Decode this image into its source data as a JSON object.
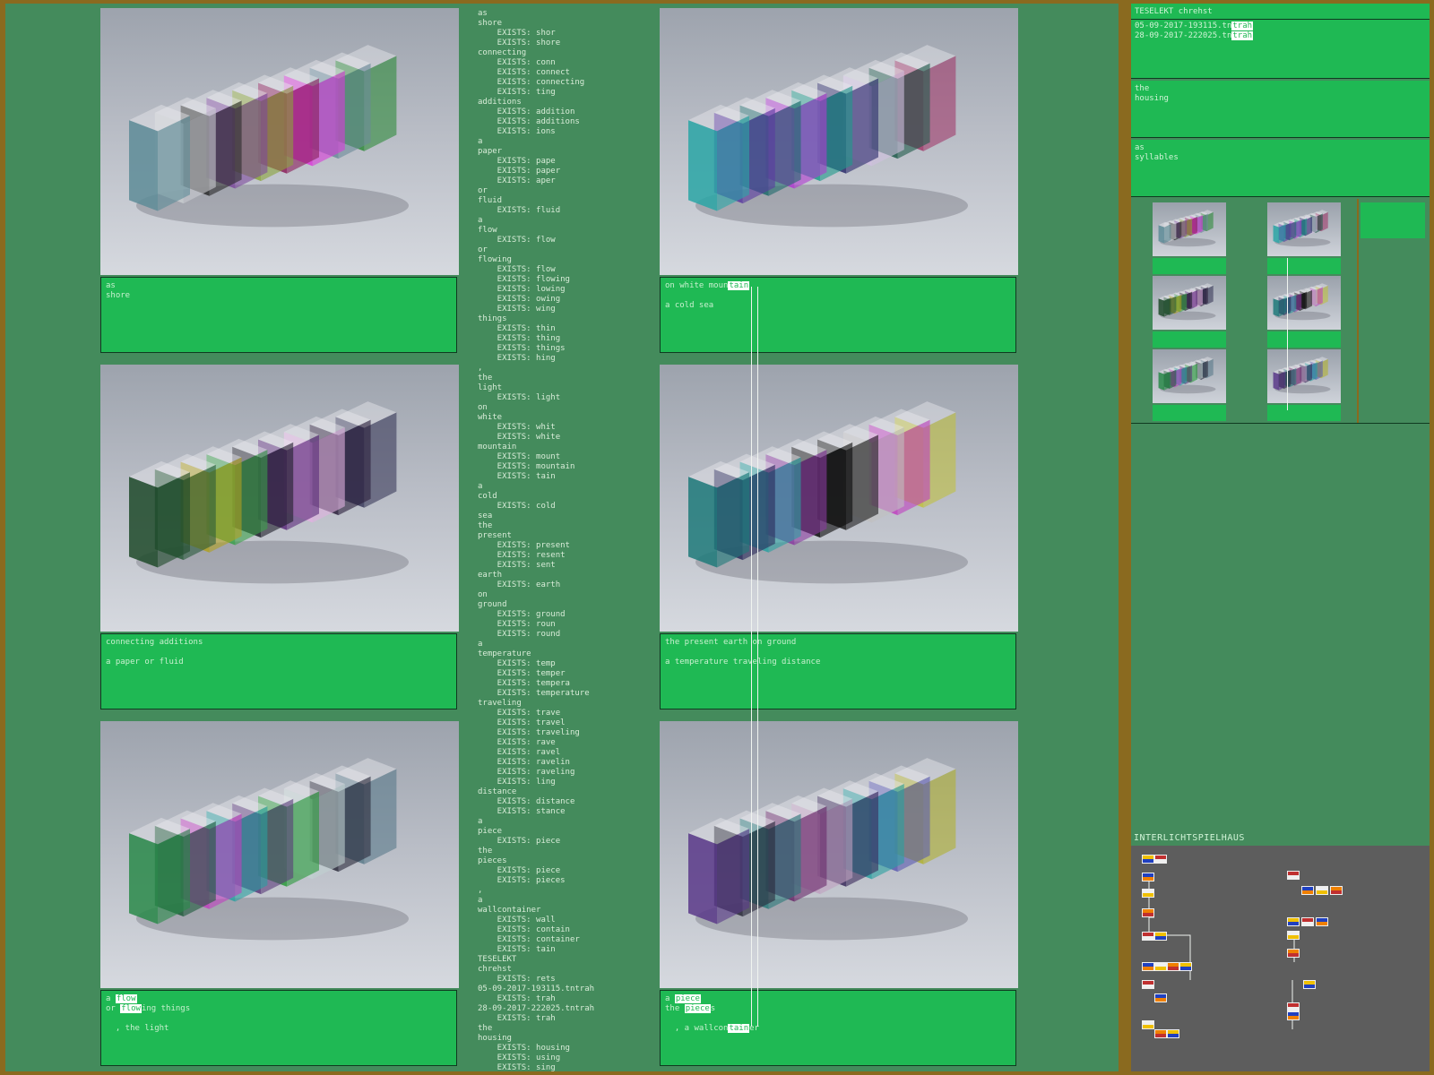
{
  "tiles": [
    {
      "id": "t1",
      "lines": [
        "as",
        "shore"
      ],
      "palette": [
        "#5e8c98",
        "#c9ccd0",
        "#2a2a2a",
        "#7d4a9c",
        "#8aa43a",
        "#8b1e5a",
        "#d93ad8",
        "#6a8b9a",
        "#2f8a3a"
      ]
    },
    {
      "id": "t2",
      "lines": [
        "on white moun[tain]",
        "",
        "a cold sea"
      ],
      "palette": [
        "#2aa6a6",
        "#5a3aa0",
        "#1e6b6b",
        "#b03ad0",
        "#1e9a8a",
        "#2a2a6a",
        "#d0c0e0",
        "#1e5a4a",
        "#a03a6a"
      ]
    },
    {
      "id": "t3",
      "lines": [
        "connecting additions",
        "",
        "a paper or fluid"
      ],
      "palette": [
        "#1e4a2a",
        "#2a5a3a",
        "#b0a020",
        "#3aa04a",
        "#1e1e2a",
        "#5a2a7a",
        "#e0b0e0",
        "#2a1e3a",
        "#3a3a5a"
      ]
    },
    {
      "id": "t4",
      "lines": [
        "the present earth on ground",
        "",
        "a temperature traveling distance"
      ],
      "palette": [
        "#1e7a7a",
        "#2a2a5a",
        "#2aa0a0",
        "#8a3aa0",
        "#0a0a0a",
        "#1e1e1e",
        "#c0c0c0",
        "#c040c0",
        "#c0c040"
      ]
    },
    {
      "id": "t5",
      "lines": [
        "a [flow]",
        "or [flow]ing things",
        "",
        "  , the light"
      ],
      "palette": [
        "#2a8a4a",
        "#1e5a3a",
        "#c040c0",
        "#2aa0a0",
        "#5a3a7a",
        "#2a9a3a",
        "#c0d0d0",
        "#2a2a3a",
        "#5a7a8a"
      ]
    },
    {
      "id": "t6",
      "lines": [
        "a [piece]",
        "the [piece]s",
        "",
        "  , a wallcon[tain]er"
      ],
      "palette": [
        "#5a3a8a",
        "#2a2a3a",
        "#2a7a7a",
        "#6a2a6a",
        "#c0a0c0",
        "#3a2a5a",
        "#2aa0a0",
        "#5a5ab0",
        "#b0b030"
      ]
    }
  ],
  "wordlist": [
    "as",
    "shore",
    "    EXISTS: shor",
    "    EXISTS: shore",
    "connecting",
    "    EXISTS: conn",
    "    EXISTS: connect",
    "    EXISTS: connecting",
    "    EXISTS: ting",
    "additions",
    "    EXISTS: addition",
    "    EXISTS: additions",
    "    EXISTS: ions",
    "a",
    "paper",
    "    EXISTS: pape",
    "    EXISTS: paper",
    "    EXISTS: aper",
    "or",
    "fluid",
    "    EXISTS: fluid",
    "a",
    "flow",
    "    EXISTS: flow",
    "or",
    "flowing",
    "    EXISTS: flow",
    "    EXISTS: flowing",
    "    EXISTS: lowing",
    "    EXISTS: owing",
    "    EXISTS: wing",
    "things",
    "    EXISTS: thin",
    "    EXISTS: thing",
    "    EXISTS: things",
    "    EXISTS: hing",
    ",",
    "the",
    "light",
    "    EXISTS: light",
    "on",
    "white",
    "    EXISTS: whit",
    "    EXISTS: white",
    "mountain",
    "    EXISTS: mount",
    "    EXISTS: mountain",
    "    EXISTS: tain",
    "a",
    "cold",
    "    EXISTS: cold",
    "sea",
    "the",
    "present",
    "    EXISTS: present",
    "    EXISTS: resent",
    "    EXISTS: sent",
    "earth",
    "    EXISTS: earth",
    "on",
    "ground",
    "    EXISTS: ground",
    "    EXISTS: roun",
    "    EXISTS: round",
    "a",
    "temperature",
    "    EXISTS: temp",
    "    EXISTS: temper",
    "    EXISTS: tempera",
    "    EXISTS: temperature",
    "traveling",
    "    EXISTS: trave",
    "    EXISTS: travel",
    "    EXISTS: traveling",
    "    EXISTS: rave",
    "    EXISTS: ravel",
    "    EXISTS: ravelin",
    "    EXISTS: raveling",
    "    EXISTS: ling",
    "distance",
    "    EXISTS: distance",
    "    EXISTS: stance",
    "a",
    "piece",
    "    EXISTS: piece",
    "the",
    "pieces",
    "    EXISTS: piece",
    "    EXISTS: pieces",
    ",",
    "a",
    "wallcontainer",
    "    EXISTS: wall",
    "    EXISTS: contain",
    "    EXISTS: container",
    "    EXISTS: tain",
    "TESELEKT",
    "chrehst",
    "    EXISTS: rets",
    "05-09-2017-193115.tntrah",
    "    EXISTS: trah",
    "28-09-2017-222025.tntrah",
    "    EXISTS: trah",
    "the",
    "housing",
    "    EXISTS: housing",
    "    EXISTS: using",
    "    EXISTS: sing"
  ],
  "side": {
    "header_title": "TESELEKT chrehst",
    "files": [
      "05-09-2017-193115.tn[trah]",
      "28-09-2017-222025.tn[trah]"
    ],
    "panel2": [
      "the",
      "housing"
    ],
    "panel3": [
      "as",
      "syllables"
    ],
    "graph_title": "INTERLICHTSPIELHAUS"
  }
}
